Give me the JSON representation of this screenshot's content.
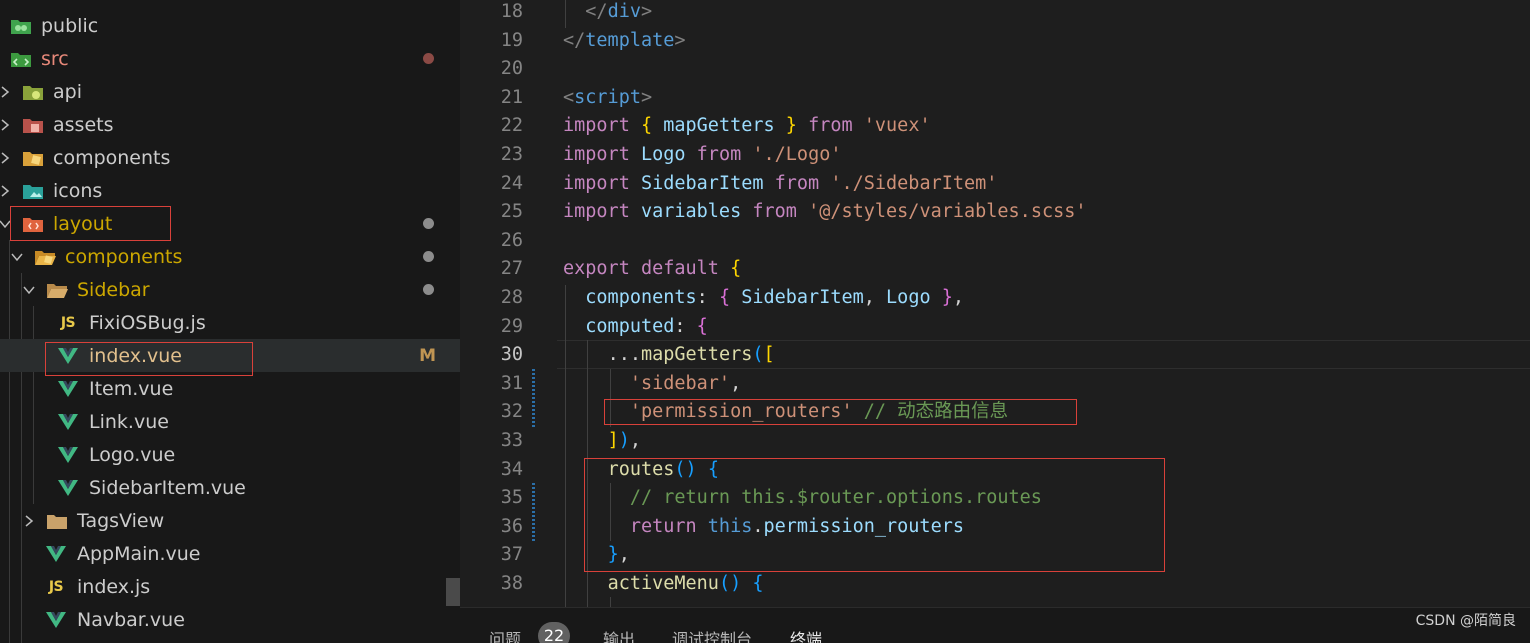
{
  "explorer": {
    "items": [
      {
        "label": "public",
        "color": "#cccccc",
        "icon": "folder-public-icon"
      },
      {
        "label": "src",
        "color": "#e8897a",
        "icon": "folder-src-icon"
      },
      {
        "label": "api",
        "color": "#cccccc",
        "icon": "folder-api-icon"
      },
      {
        "label": "assets",
        "color": "#cccccc",
        "icon": "folder-assets-icon"
      },
      {
        "label": "components",
        "color": "#cccccc",
        "icon": "folder-components-icon"
      },
      {
        "label": "icons",
        "color": "#cccccc",
        "icon": "folder-images-icon"
      },
      {
        "label": "layout",
        "color": "#cca700",
        "icon": "folder-layout-icon"
      },
      {
        "label": "components",
        "color": "#cca700",
        "icon": "folder-components-open-icon"
      },
      {
        "label": "Sidebar",
        "color": "#cca700",
        "icon": "folder-open-icon"
      },
      {
        "label": "FixiOSBug.js",
        "color": "#cccccc",
        "icon": "javascript-file-icon",
        "badge": "JS"
      },
      {
        "label": "index.vue",
        "color": "#e2c08d",
        "icon": "vue-file-icon",
        "git_status": "M"
      },
      {
        "label": "Item.vue",
        "color": "#cccccc",
        "icon": "vue-file-icon"
      },
      {
        "label": "Link.vue",
        "color": "#cccccc",
        "icon": "vue-file-icon"
      },
      {
        "label": "Logo.vue",
        "color": "#cccccc",
        "icon": "vue-file-icon"
      },
      {
        "label": "SidebarItem.vue",
        "color": "#cccccc",
        "icon": "vue-file-icon"
      },
      {
        "label": "TagsView",
        "color": "#cccccc",
        "icon": "folder-icon"
      },
      {
        "label": "AppMain.vue",
        "color": "#cccccc",
        "icon": "vue-file-icon"
      },
      {
        "label": "index.js",
        "color": "#cccccc",
        "icon": "javascript-file-icon",
        "badge": "JS"
      },
      {
        "label": "Navbar.vue",
        "color": "#cccccc",
        "icon": "vue-file-icon"
      }
    ]
  },
  "editor": {
    "active_line": "30",
    "lines": [
      {
        "n": "18",
        "text": "  </div>"
      },
      {
        "n": "19",
        "text": "</template>"
      },
      {
        "n": "20",
        "text": ""
      },
      {
        "n": "21",
        "text": "<script>"
      },
      {
        "n": "22",
        "text": "import { mapGetters } from 'vuex'"
      },
      {
        "n": "23",
        "text": "import Logo from './Logo'"
      },
      {
        "n": "24",
        "text": "import SidebarItem from './SidebarItem'"
      },
      {
        "n": "25",
        "text": "import variables from '@/styles/variables.scss'"
      },
      {
        "n": "26",
        "text": ""
      },
      {
        "n": "27",
        "text": "export default {"
      },
      {
        "n": "28",
        "text": "  components: { SidebarItem, Logo },"
      },
      {
        "n": "29",
        "text": "  computed: {"
      },
      {
        "n": "30",
        "text": "    ...mapGetters(["
      },
      {
        "n": "31",
        "text": "      'sidebar',"
      },
      {
        "n": "32",
        "text": "      'permission_routers' // 动态路由信息"
      },
      {
        "n": "33",
        "text": "    ]),"
      },
      {
        "n": "34",
        "text": "    routes() {"
      },
      {
        "n": "35",
        "text": "      // return this.$router.options.routes"
      },
      {
        "n": "36",
        "text": "      return this.permission_routers"
      },
      {
        "n": "37",
        "text": "    },"
      },
      {
        "n": "38",
        "text": "    activeMenu() {"
      }
    ]
  },
  "panel": {
    "tabs": [
      {
        "label": "问题"
      },
      {
        "label": "输出"
      },
      {
        "label": "调试控制台"
      },
      {
        "label": "终端"
      }
    ],
    "problems_count": "22",
    "active_tab": "终端"
  },
  "watermark": "CSDN @陌简良",
  "colors": {
    "annotation_box": "#d9413a",
    "vue_icon": "#41b883",
    "modified": "#e2c08d"
  }
}
